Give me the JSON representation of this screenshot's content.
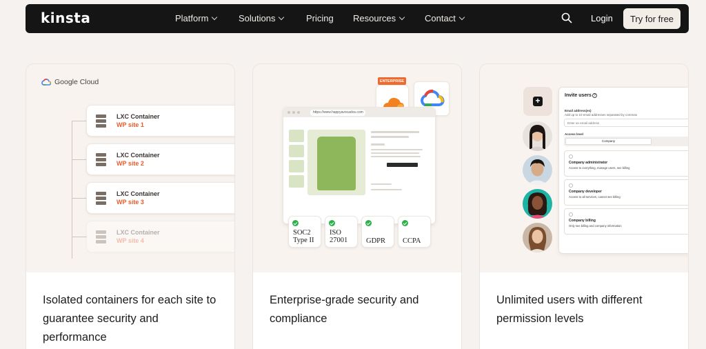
{
  "nav": {
    "logo": "kinsta",
    "items": [
      {
        "label": "Platform",
        "dropdown": true
      },
      {
        "label": "Solutions",
        "dropdown": true
      },
      {
        "label": "Pricing",
        "dropdown": false
      },
      {
        "label": "Resources",
        "dropdown": true
      },
      {
        "label": "Contact",
        "dropdown": true
      }
    ],
    "login": "Login",
    "cta": "Try for free"
  },
  "card1": {
    "provider": "Google Cloud",
    "containers": [
      {
        "title": "LXC Container",
        "site": "WP site 1"
      },
      {
        "title": "LXC Container",
        "site": "WP site 2"
      },
      {
        "title": "LXC Container",
        "site": "WP site 3"
      },
      {
        "title": "LXC Container",
        "site": "WP site 4"
      }
    ],
    "text": "Isolated containers for each site to guarantee security and performance"
  },
  "card2": {
    "badge": "ENTERPRISE",
    "url": "https://www.happyavocados.com",
    "certs": [
      {
        "label": "SOC2\nType II"
      },
      {
        "label": "ISO\n27001"
      },
      {
        "label": "GDPR"
      },
      {
        "label": "CCPA"
      }
    ],
    "text": "Enterprise-grade security and compliance"
  },
  "card3": {
    "panel": {
      "title": "Invite users",
      "email_label": "Email address(es)",
      "email_hint": "Add up to 10 email addresses separated by commas",
      "email_placeholder": "Enter an email address",
      "access_label": "Access level",
      "access_selected": "Company",
      "roles": [
        {
          "title": "Company administrator",
          "desc": "Access to everything, manage users, see billing"
        },
        {
          "title": "Company developer",
          "desc": "Access to all services, cannot see billing"
        },
        {
          "title": "Company billing",
          "desc": "Only see billing and company information"
        }
      ]
    },
    "text": "Unlimited users with different permission levels"
  },
  "colors": {
    "nav_bg": "#151515",
    "accent_orange": "#e85c2b",
    "check_green": "#2cb24a",
    "page_bg": "#f6f2ef"
  }
}
